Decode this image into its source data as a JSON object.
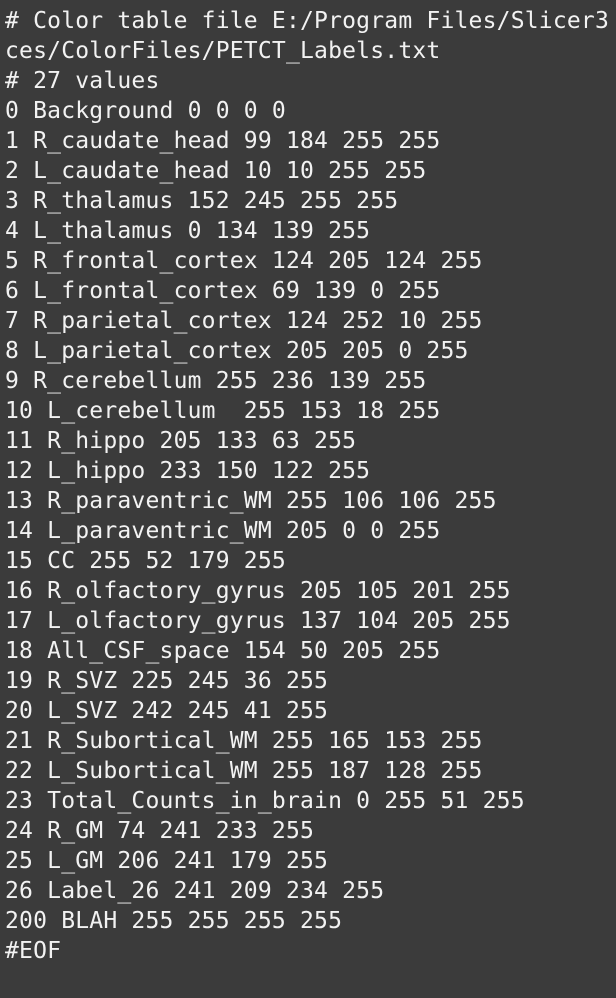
{
  "terminal": {
    "lines": [
      "# Color table file E:/Program Files/Slicer3",
      "ces/ColorFiles/PETCT_Labels.txt",
      "# 27 values",
      "0 Background 0 0 0 0",
      "1 R_caudate_head 99 184 255 255",
      "2 L_caudate_head 10 10 255 255",
      "3 R_thalamus 152 245 255 255",
      "4 L_thalamus 0 134 139 255",
      "5 R_frontal_cortex 124 205 124 255",
      "6 L_frontal_cortex 69 139 0 255",
      "7 R_parietal_cortex 124 252 10 255",
      "8 L_parietal_cortex 205 205 0 255",
      "9 R_cerebellum 255 236 139 255",
      "10 L_cerebellum  255 153 18 255",
      "11 R_hippo 205 133 63 255",
      "12 L_hippo 233 150 122 255",
      "13 R_paraventric_WM 255 106 106 255",
      "14 L_paraventric_WM 205 0 0 255",
      "15 CC 255 52 179 255",
      "16 R_olfactory_gyrus 205 105 201 255",
      "17 L_olfactory_gyrus 137 104 205 255",
      "18 All_CSF_space 154 50 205 255",
      "19 R_SVZ 225 245 36 255",
      "20 L_SVZ 242 245 41 255",
      "21 R_Subortical_WM 255 165 153 255",
      "22 L_Subortical_WM 255 187 128 255",
      "23 Total_Counts_in_brain 0 255 51 255",
      "24 R_GM 74 241 233 255",
      "25 L_GM 206 241 179 255",
      "26 Label_26 241 209 234 255",
      "200 BLAH 255 255 255 255",
      "#EOF"
    ],
    "colors": {
      "background": "#3b3b3b",
      "text": "#f2f2f2"
    }
  }
}
